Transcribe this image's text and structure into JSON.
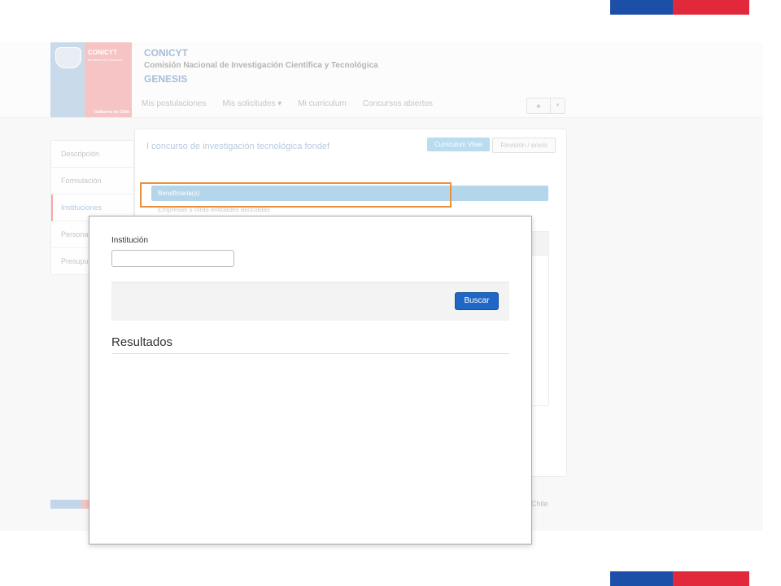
{
  "header": {
    "logo": {
      "brand": "CONICYT",
      "brand_sub": "Ministerio de Educación",
      "gov": "Gobierno de Chile"
    },
    "title1": "CONICYT",
    "title2": "Comisión Nacional de Investigación Científica y Tecnológica",
    "title3": "GENESIS",
    "nav": [
      "Mis postulaciones",
      "Mis solicitudes ▾",
      "Mi curriculum",
      "Concursos abiertos"
    ],
    "user_icon": "user-icon",
    "user_caret": "▾"
  },
  "sidebar": {
    "items": [
      {
        "label": "Descripción"
      },
      {
        "label": "Formulación"
      },
      {
        "label": "Instituciones"
      },
      {
        "label": "Persona"
      },
      {
        "label": "Presupu"
      }
    ]
  },
  "panel": {
    "title": "I concurso de investigación tecnológica fondef",
    "cv_button": "Curriculum Vitae",
    "review_button": "Revisión / envío",
    "beneficiaria_bar": "Beneficiaria(s)",
    "sub_text": "Empresas u otras entidades asociadas"
  },
  "footer": {
    "text": "Chile"
  },
  "modal": {
    "institucion_label": "Institución",
    "institucion_value": "",
    "buscar_button": "Buscar",
    "resultados_title": "Resultados"
  },
  "colors": {
    "flag_blue": "#1c4fa8",
    "flag_red": "#e2283b",
    "highlight": "#e8913c",
    "primary_button": "#1f67c4"
  }
}
